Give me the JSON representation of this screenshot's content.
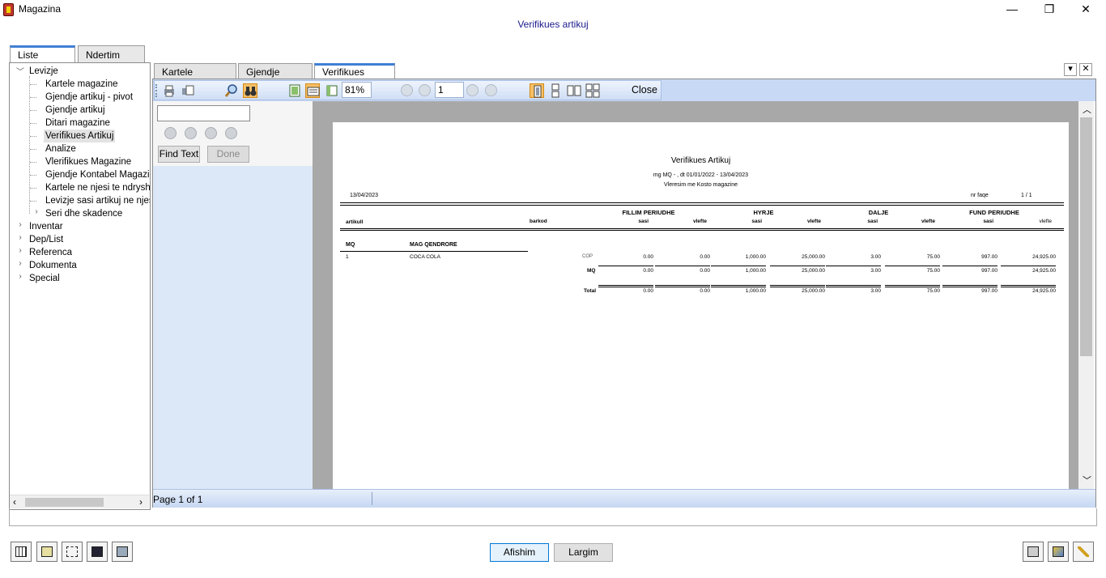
{
  "window": {
    "title": "Magazina",
    "subtitle": "Verifikues artikuj",
    "minimize": "—",
    "restore": "❐",
    "close": "✕"
  },
  "left_tabs": [
    {
      "label": "Liste raporte"
    },
    {
      "label": "Ndertim filter"
    }
  ],
  "tree": {
    "root": "Levizje",
    "children": [
      "Kartele magazine",
      "Gjendje artikuj - pivot",
      "Gjendje artikuj",
      "Ditari magazine",
      "Verifikues Artikuj",
      "Analize",
      "Vlerifikues Magazine",
      "Gjendje Kontabel Magazina",
      "Kartele ne njesi te ndryshme",
      "Levizje sasi artikuj ne njesi",
      "Seri dhe skadence"
    ],
    "groups": [
      "Inventar",
      "Dep/List",
      "Referenca",
      "Dokumenta",
      "Special"
    ]
  },
  "right_tabs": [
    {
      "label": "Kartele magazine"
    },
    {
      "label": "Gjendje artikuj"
    },
    {
      "label": "Verifikues artikuj"
    }
  ],
  "toolbar": {
    "zoom": "81%",
    "page": "1",
    "close_label": "Close"
  },
  "find": {
    "find_label": "Find Text",
    "done_label": "Done"
  },
  "status": {
    "page_text": "Page 1 of 1"
  },
  "report": {
    "title": "Verifikues Artikuj",
    "params": "mg MQ - , dt 01/01/2022 - 13/04/2023",
    "valuation": "Vleresim me Kosto magazine",
    "date": "13/04/2023",
    "page_label": "nr faqe",
    "page_value": "1  /  1",
    "col_artikull": "artikull",
    "col_barkod": "barkod",
    "groups": [
      "FILLIM PERIUDHE",
      "HYRJE",
      "DALJE",
      "FUND PERIUDHE"
    ],
    "sub_sasi": "sasi",
    "sub_vlefte": "vlefte",
    "warehouse_code": "MQ",
    "warehouse_name": "MAG QENDRORE",
    "item": {
      "code": "1",
      "name": "COCA COLA",
      "unit": "COP",
      "values": [
        "0.00",
        "0.00",
        "1,000.00",
        "25,000.00",
        "3.00",
        "75.00",
        "997.00",
        "24,925.00"
      ]
    },
    "subtotal": {
      "label": "MQ",
      "values": [
        "0.00",
        "0.00",
        "1,000.00",
        "25,000.00",
        "3.00",
        "75.00",
        "997.00",
        "24,925.00"
      ]
    },
    "total": {
      "label": "Total",
      "values": [
        "0.00",
        "0.00",
        "1,000.00",
        "25,000.00",
        "3.00",
        "75.00",
        "997.00",
        "24,925.00"
      ]
    }
  },
  "bottom": {
    "show_label": "Afishim",
    "exit_label": "Largim"
  }
}
